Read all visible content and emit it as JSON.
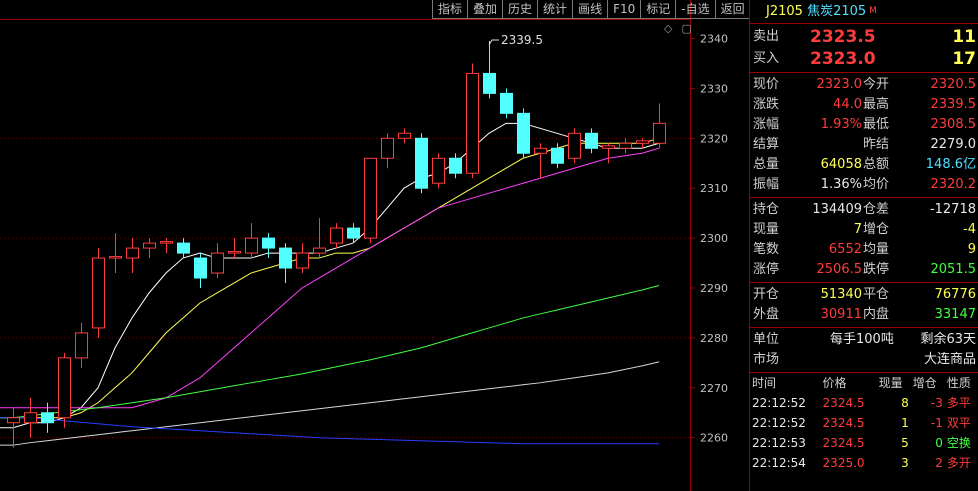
{
  "toolbar": {
    "items": [
      "指标",
      "叠加",
      "历史",
      "统计",
      "画线",
      "F10",
      "标记",
      "-自选",
      "返回"
    ]
  },
  "chart_data": {
    "type": "candlestick",
    "y_ticks": [
      2340,
      2330,
      2320,
      2310,
      2300,
      2290,
      2280,
      2270,
      2260
    ],
    "peak_label": "2339.5",
    "current_price_line": 2320,
    "candles": [
      {
        "o": 2263,
        "c": 2264,
        "h": 2266,
        "l": 2258
      },
      {
        "o": 2263,
        "c": 2265,
        "h": 2268,
        "l": 2260
      },
      {
        "o": 2265,
        "c": 2263,
        "h": 2267,
        "l": 2261
      },
      {
        "o": 2264,
        "c": 2276,
        "h": 2277,
        "l": 2262
      },
      {
        "o": 2276,
        "c": 2281,
        "h": 2283,
        "l": 2274
      },
      {
        "o": 2282,
        "c": 2296,
        "h": 2298,
        "l": 2280
      },
      {
        "o": 2296,
        "c": 2296.3,
        "h": 2301,
        "l": 2293
      },
      {
        "o": 2296,
        "c": 2298,
        "h": 2300,
        "l": 2293
      },
      {
        "o": 2298,
        "c": 2299,
        "h": 2300,
        "l": 2296
      },
      {
        "o": 2299,
        "c": 2299.3,
        "h": 2300,
        "l": 2297
      },
      {
        "o": 2299,
        "c": 2297,
        "h": 2300,
        "l": 2296
      },
      {
        "o": 2296,
        "c": 2292,
        "h": 2297,
        "l": 2290
      },
      {
        "o": 2293,
        "c": 2297,
        "h": 2299,
        "l": 2292
      },
      {
        "o": 2297,
        "c": 2297.3,
        "h": 2300,
        "l": 2296
      },
      {
        "o": 2297,
        "c": 2300,
        "h": 2303,
        "l": 2296
      },
      {
        "o": 2300,
        "c": 2298,
        "h": 2301,
        "l": 2296
      },
      {
        "o": 2298,
        "c": 2294,
        "h": 2299,
        "l": 2291
      },
      {
        "o": 2294,
        "c": 2297,
        "h": 2299,
        "l": 2293
      },
      {
        "o": 2297,
        "c": 2298,
        "h": 2304,
        "l": 2296
      },
      {
        "o": 2299,
        "c": 2302,
        "h": 2303,
        "l": 2298
      },
      {
        "o": 2302,
        "c": 2300,
        "h": 2303,
        "l": 2299
      },
      {
        "o": 2300,
        "c": 2316,
        "h": 2316,
        "l": 2299
      },
      {
        "o": 2316,
        "c": 2320,
        "h": 2321,
        "l": 2314
      },
      {
        "o": 2320,
        "c": 2321,
        "h": 2322,
        "l": 2319
      },
      {
        "o": 2320,
        "c": 2310,
        "h": 2321,
        "l": 2309
      },
      {
        "o": 2311,
        "c": 2316,
        "h": 2317,
        "l": 2310
      },
      {
        "o": 2316,
        "c": 2313,
        "h": 2317,
        "l": 2312
      },
      {
        "o": 2313,
        "c": 2333,
        "h": 2335,
        "l": 2312
      },
      {
        "o": 2333,
        "c": 2329,
        "h": 2339.5,
        "l": 2328
      },
      {
        "o": 2329,
        "c": 2325,
        "h": 2330,
        "l": 2324
      },
      {
        "o": 2325,
        "c": 2317,
        "h": 2326,
        "l": 2316
      },
      {
        "o": 2317,
        "c": 2318,
        "h": 2319,
        "l": 2312
      },
      {
        "o": 2318,
        "c": 2315,
        "h": 2319,
        "l": 2314
      },
      {
        "o": 2316,
        "c": 2321,
        "h": 2322,
        "l": 2315
      },
      {
        "o": 2321,
        "c": 2318,
        "h": 2322,
        "l": 2317
      },
      {
        "o": 2318,
        "c": 2318.5,
        "h": 2319,
        "l": 2315
      },
      {
        "o": 2318,
        "c": 2319,
        "h": 2320,
        "l": 2317
      },
      {
        "o": 2319,
        "c": 2319.5,
        "h": 2320,
        "l": 2318
      },
      {
        "o": 2319,
        "c": 2323,
        "h": 2327,
        "l": 2318
      }
    ],
    "ma_lines": [
      {
        "color": "#ffffff",
        "values": [
          2262,
          2263,
          2263,
          2264,
          2266,
          2270,
          2278,
          2284,
          2289,
          2293,
          2296,
          2297,
          2296,
          2296,
          2296,
          2297,
          2297,
          2297,
          2297,
          2298,
          2299,
          2302,
          2306,
          2310,
          2312,
          2313,
          2315,
          2318,
          2321,
          2323,
          2323,
          2322,
          2321,
          2320,
          2319,
          2318,
          2318,
          2318,
          2319
        ]
      },
      {
        "color": "#ffff54",
        "values": [
          2264,
          2264,
          2264,
          2264,
          2265,
          2267,
          2270,
          2273,
          2277,
          2281,
          2284,
          2287,
          2289,
          2291,
          2293,
          2294,
          2295,
          2296,
          2296,
          2297,
          2297,
          2298,
          2300,
          2302,
          2304,
          2306,
          2308,
          2310,
          2312,
          2314,
          2316,
          2317,
          2318,
          2319,
          2319,
          2319,
          2319,
          2319,
          2320
        ]
      },
      {
        "color": "#ff40ff",
        "values": [
          2266,
          2266,
          2266,
          2266,
          2266,
          2266,
          2266,
          2266,
          2267,
          2268,
          2270,
          2272,
          2275,
          2278,
          2281,
          2284,
          2287,
          2290,
          2292,
          2294,
          2296,
          2298,
          2300,
          2302,
          2304,
          2306,
          2307,
          2308,
          2309,
          2310,
          2311,
          2312,
          2313,
          2314,
          2315,
          2316,
          2316.5,
          2317,
          2318
        ]
      },
      {
        "color": "#40ff40",
        "values": [
          2264,
          2264.4,
          2264.8,
          2265.2,
          2265.6,
          2266,
          2266.5,
          2267,
          2267.5,
          2268,
          2268.6,
          2269.2,
          2269.8,
          2270.4,
          2271,
          2271.6,
          2272.2,
          2272.8,
          2273.5,
          2274.2,
          2274.9,
          2275.6,
          2276.4,
          2277.2,
          2278,
          2279,
          2280,
          2281,
          2282,
          2283,
          2284,
          2284.8,
          2285.6,
          2286.4,
          2287.2,
          2288,
          2288.8,
          2289.6,
          2290.5
        ]
      },
      {
        "color": "#d8d8d8",
        "values": [
          2258.5,
          2259,
          2259.4,
          2259.8,
          2260.2,
          2260.6,
          2261,
          2261.4,
          2261.8,
          2262.2,
          2262.6,
          2263,
          2263.4,
          2263.8,
          2264.2,
          2264.6,
          2265,
          2265.4,
          2265.8,
          2266.2,
          2266.6,
          2267,
          2267.4,
          2267.8,
          2268.2,
          2268.6,
          2269,
          2269.4,
          2269.8,
          2270.2,
          2270.6,
          2271,
          2271.5,
          2272,
          2272.5,
          2273,
          2273.7,
          2274.4,
          2275.2
        ]
      },
      {
        "color": "#2a3cff",
        "values": [
          2264,
          2264,
          2263.7,
          2263.4,
          2263.1,
          2262.8,
          2262.5,
          2262.2,
          2262,
          2261.8,
          2261.6,
          2261.4,
          2261.2,
          2261,
          2260.8,
          2260.6,
          2260.4,
          2260.2,
          2260,
          2259.9,
          2259.8,
          2259.7,
          2259.6,
          2259.5,
          2259.4,
          2259.3,
          2259.2,
          2259.1,
          2259,
          2258.9,
          2258.8,
          2258.8,
          2258.8,
          2258.8,
          2258.8,
          2258.8,
          2258.8,
          2258.8,
          2258.8
        ]
      }
    ]
  },
  "panel": {
    "code": "J2105",
    "name": "焦炭2105",
    "marker": "M",
    "sell": {
      "label": "卖出",
      "price": "2323.5",
      "qty": "11"
    },
    "buy": {
      "label": "买入",
      "price": "2323.0",
      "qty": "17"
    },
    "stats1": [
      {
        "l1": "现价",
        "v1": "2323.0",
        "c1": "red",
        "l2": "今开",
        "v2": "2320.5",
        "c2": "red"
      },
      {
        "l1": "涨跌",
        "v1": "44.0",
        "c1": "red",
        "l2": "最高",
        "v2": "2339.5",
        "c2": "red"
      },
      {
        "l1": "涨幅",
        "v1": "1.93%",
        "c1": "red",
        "l2": "最低",
        "v2": "2308.5",
        "c2": "red"
      },
      {
        "l1": "结算",
        "v1": "",
        "c1": "white",
        "l2": "昨结",
        "v2": "2279.0",
        "c2": "white"
      },
      {
        "l1": "总量",
        "v1": "64058",
        "c1": "yellow",
        "l2": "总额",
        "v2": "148.6亿",
        "c2": "cyan"
      },
      {
        "l1": "振幅",
        "v1": "1.36%",
        "c1": "white",
        "l2": "均价",
        "v2": "2320.2",
        "c2": "red"
      }
    ],
    "stats2": [
      {
        "l1": "持仓",
        "v1": "134409",
        "c1": "white",
        "l2": "仓差",
        "v2": "-12718",
        "c2": "white"
      },
      {
        "l1": "现量",
        "v1": "7",
        "c1": "yellow",
        "l2": "增仓",
        "v2": "-4",
        "c2": "yellow"
      },
      {
        "l1": "笔数",
        "v1": "6552",
        "c1": "red",
        "l2": "均量",
        "v2": "9",
        "c2": "yellow"
      },
      {
        "l1": "涨停",
        "v1": "2506.5",
        "c1": "red",
        "l2": "跌停",
        "v2": "2051.5",
        "c2": "green"
      }
    ],
    "stats3": [
      {
        "l1": "开仓",
        "v1": "51340",
        "c1": "yellow",
        "l2": "平仓",
        "v2": "76776",
        "c2": "yellow"
      },
      {
        "l1": "外盘",
        "v1": "30911",
        "c1": "red",
        "l2": "内盘",
        "v2": "33147",
        "c2": "green"
      }
    ],
    "unit": {
      "label": "单位",
      "value": "每手100吨",
      "extra": "剩余63天"
    },
    "market": {
      "label": "市场",
      "value": "大连商品"
    },
    "ticks_header": {
      "time": "时间",
      "price": "价格",
      "vol": "现量",
      "oi": "增仓",
      "nature": "性质"
    },
    "ticks": [
      {
        "time": "22:12:52",
        "price": "2324.5",
        "vol": "8",
        "oi": "-3",
        "oi_c": "red",
        "nature": "多平",
        "n_c": "red"
      },
      {
        "time": "22:12:52",
        "price": "2324.5",
        "vol": "1",
        "oi": "-1",
        "oi_c": "red",
        "nature": "双平",
        "n_c": "red"
      },
      {
        "time": "22:12:53",
        "price": "2324.5",
        "vol": "5",
        "oi": "0",
        "oi_c": "green",
        "nature": "空换",
        "n_c": "green"
      },
      {
        "time": "22:12:54",
        "price": "2325.0",
        "vol": "3",
        "oi": "2",
        "oi_c": "red",
        "nature": "多开",
        "n_c": "red"
      }
    ]
  }
}
